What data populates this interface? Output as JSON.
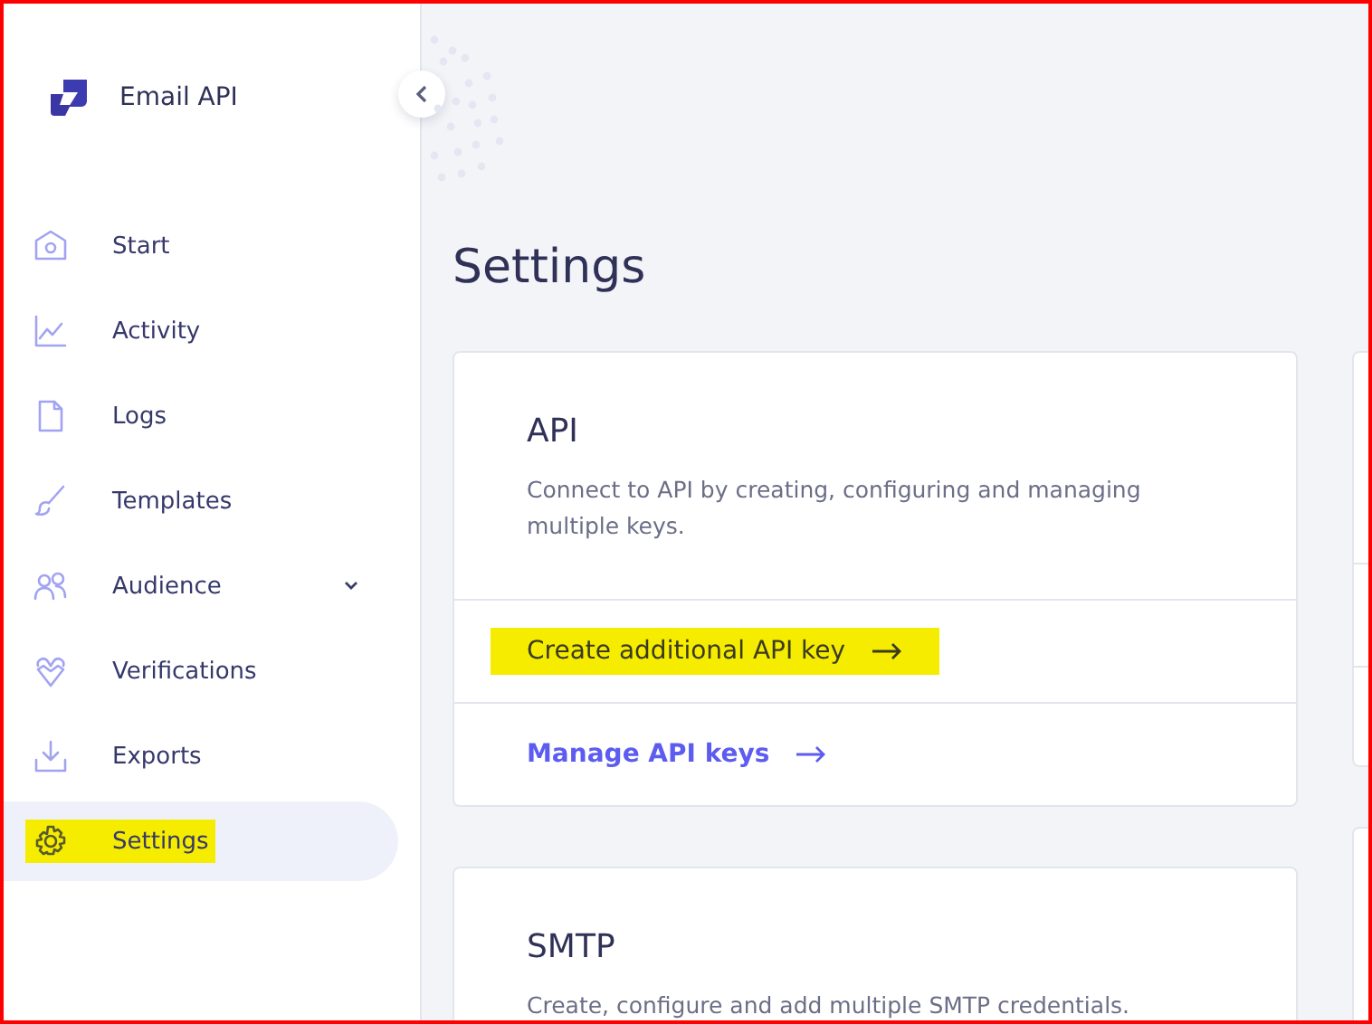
{
  "brand": {
    "name": "Email API"
  },
  "sidebar": {
    "items": [
      {
        "label": "Start",
        "selected": false,
        "highlighted": false
      },
      {
        "label": "Activity",
        "selected": false,
        "highlighted": false
      },
      {
        "label": "Logs",
        "selected": false,
        "highlighted": false
      },
      {
        "label": "Templates",
        "selected": false,
        "highlighted": false
      },
      {
        "label": "Audience",
        "selected": false,
        "highlighted": false,
        "expandable": true
      },
      {
        "label": "Verifications",
        "selected": false,
        "highlighted": false
      },
      {
        "label": "Exports",
        "selected": false,
        "highlighted": false
      },
      {
        "label": "Settings",
        "selected": true,
        "highlighted": true
      }
    ]
  },
  "page": {
    "title": "Settings"
  },
  "cards": [
    {
      "title": "API",
      "description": "Connect to API by creating, configuring and managing multiple keys.",
      "links": [
        {
          "label": "Create additional API key",
          "kind": "plain",
          "highlighted": true
        },
        {
          "label": "Manage API keys",
          "kind": "accent",
          "highlighted": false
        }
      ]
    },
    {
      "title": "SMTP",
      "description": "Create, configure and add multiple SMTP credentials."
    }
  ]
}
